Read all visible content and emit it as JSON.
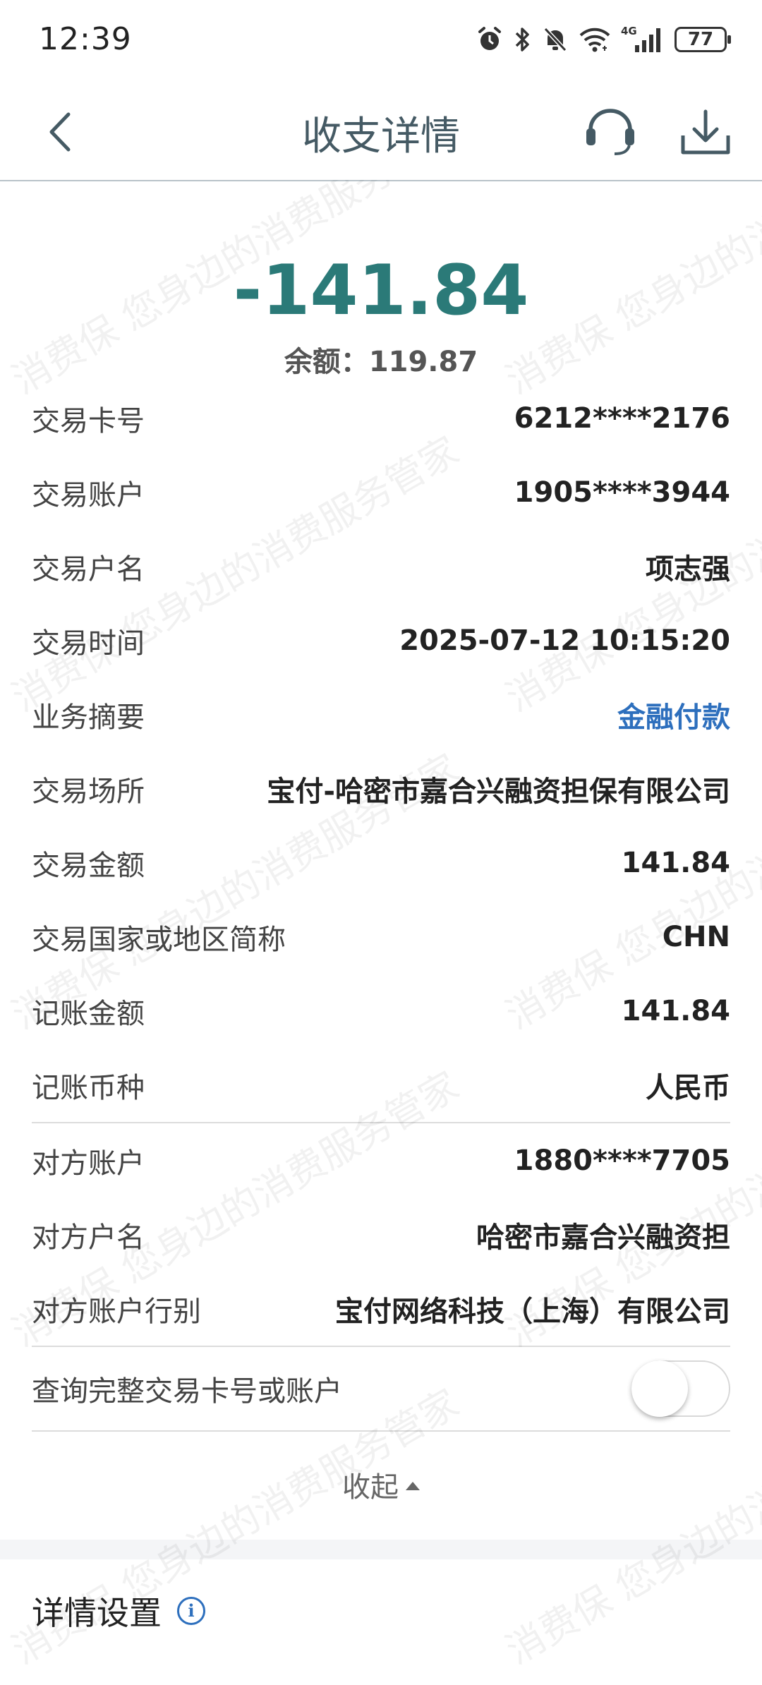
{
  "status_bar": {
    "time": "12:39",
    "icons": [
      "alarm-icon",
      "bluetooth-icon",
      "mute-icon",
      "wifi-icon",
      "signal-4g-icon"
    ],
    "network": "4G",
    "battery": "77"
  },
  "header": {
    "title": "收支详情",
    "back_icon": "chevron-left-icon",
    "support_icon": "headset-icon",
    "download_icon": "download-icon"
  },
  "watermark": {
    "text": "消费保 您身边的消费服务管家"
  },
  "summary": {
    "amount": "-141.84",
    "balance_label": "余额：",
    "balance_value": "119.87"
  },
  "details": [
    {
      "label": "交易卡号",
      "value": "6212****2176"
    },
    {
      "label": "交易账户",
      "value": "1905****3944"
    },
    {
      "label": "交易户名",
      "value": "项志强"
    },
    {
      "label": "交易时间",
      "value": "2025-07-12 10:15:20"
    },
    {
      "label": "业务摘要",
      "value": "金融付款"
    },
    {
      "label": "交易场所",
      "value": "宝付-哈密市嘉合兴融资担保有限公司"
    },
    {
      "label": "交易金额",
      "value": "141.84"
    },
    {
      "label": "交易国家或地区简称",
      "value": "CHN"
    },
    {
      "label": "记账金额",
      "value": "141.84"
    },
    {
      "label": "记账币种",
      "value": "人民币"
    }
  ],
  "counterparty": [
    {
      "label": "对方账户",
      "value": "1880****7705"
    },
    {
      "label": "对方户名",
      "value": "哈密市嘉合兴融资担"
    },
    {
      "label": "对方账户行别",
      "value": "宝付网络科技（上海）有限公司"
    }
  ],
  "query_full": {
    "label": "查询完整交易卡号或账户",
    "enabled": false
  },
  "collapse": {
    "label": "收起"
  },
  "settings": {
    "title": "详情设置",
    "info_icon": "i"
  },
  "colors": {
    "amount": "#2b7a78",
    "link": "#2d6fbd",
    "header_title": "#455a64"
  }
}
